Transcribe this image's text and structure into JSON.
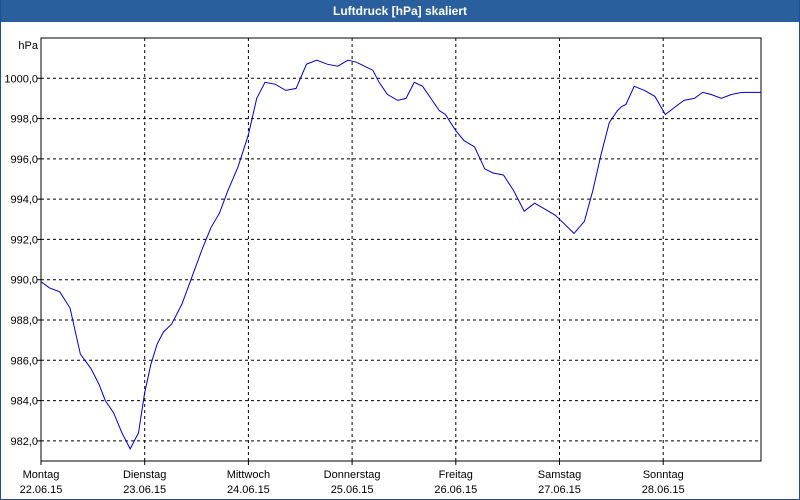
{
  "window": {
    "title": "Luftdruck [hPa] skaliert"
  },
  "chart_data": {
    "type": "line",
    "title": "Luftdruck [hPa] skaliert",
    "ylabel": "hPa",
    "xlabel": "",
    "ylim": [
      981.0,
      1002.0
    ],
    "xlim": [
      0,
      7
    ],
    "yticks": [
      982.0,
      984.0,
      986.0,
      988.0,
      990.0,
      992.0,
      994.0,
      996.0,
      998.0,
      1000.0
    ],
    "ytick_labels": [
      "982,0",
      "984,0",
      "986,0",
      "988,0",
      "990,0",
      "992,0",
      "994,0",
      "996,0",
      "998,0",
      "1000,0"
    ],
    "xticks": [
      {
        "day": "Montag",
        "date": "22.06.15",
        "x": 0
      },
      {
        "day": "Dienstag",
        "date": "23.06.15",
        "x": 1
      },
      {
        "day": "Mittwoch",
        "date": "24.06.15",
        "x": 2
      },
      {
        "day": "Donnerstag",
        "date": "25.06.15",
        "x": 3
      },
      {
        "day": "Freitag",
        "date": "26.06.15",
        "x": 4
      },
      {
        "day": "Samstag",
        "date": "27.06.15",
        "x": 5
      },
      {
        "day": "Sonntag",
        "date": "28.06.15",
        "x": 6
      }
    ],
    "grid": true,
    "line_color": "#0000cc",
    "series": [
      {
        "x": [
          0.0,
          0.08,
          0.18,
          0.28,
          0.38,
          0.48,
          0.56,
          0.62,
          0.7,
          0.78,
          0.86,
          0.94,
          1.0,
          1.06,
          1.12,
          1.18,
          1.26,
          1.36,
          1.46,
          1.56,
          1.64,
          1.72,
          1.8,
          1.9,
          2.0,
          2.08,
          2.16,
          2.26,
          2.36,
          2.46,
          2.56,
          2.66,
          2.76,
          2.86,
          2.96,
          3.04,
          3.12,
          3.2,
          3.26,
          3.34,
          3.44,
          3.52,
          3.6,
          3.68,
          3.76,
          3.84,
          3.9,
          4.0,
          4.08,
          4.18,
          4.28,
          4.36,
          4.46,
          4.56,
          4.66,
          4.76,
          4.86,
          4.96,
          5.04,
          5.14,
          5.24,
          5.32,
          5.4,
          5.48,
          5.56,
          5.6,
          5.64,
          5.72,
          5.82,
          5.92,
          6.02,
          6.12,
          6.2,
          6.3,
          6.38,
          6.46,
          6.56,
          6.66,
          6.76,
          6.86,
          6.94,
          7.02
        ],
        "values": [
          989.9,
          989.6,
          989.4,
          988.6,
          986.3,
          985.6,
          984.8,
          984.0,
          983.4,
          982.4,
          981.6,
          982.4,
          984.4,
          985.8,
          986.8,
          987.4,
          987.8,
          988.8,
          990.2,
          991.6,
          992.6,
          993.3,
          994.4,
          995.6,
          997.2,
          999.0,
          999.8,
          999.7,
          999.4,
          999.5,
          1000.7,
          1000.9,
          1000.7,
          1000.6,
          1000.9,
          1000.8,
          1000.6,
          1000.4,
          999.8,
          999.2,
          998.9,
          999.0,
          999.8,
          999.6,
          999.0,
          998.4,
          998.2,
          997.4,
          996.9,
          996.6,
          995.5,
          995.3,
          995.2,
          994.4,
          993.4,
          993.8,
          993.5,
          993.2,
          992.8,
          992.3,
          992.9,
          994.4,
          996.2,
          997.8,
          998.4,
          998.6,
          998.7,
          999.6,
          999.4,
          999.1,
          998.2,
          998.6,
          998.9,
          999.0,
          999.3,
          999.2,
          999.0,
          999.2,
          999.3,
          999.3,
          999.3,
          999.4
        ]
      }
    ]
  }
}
